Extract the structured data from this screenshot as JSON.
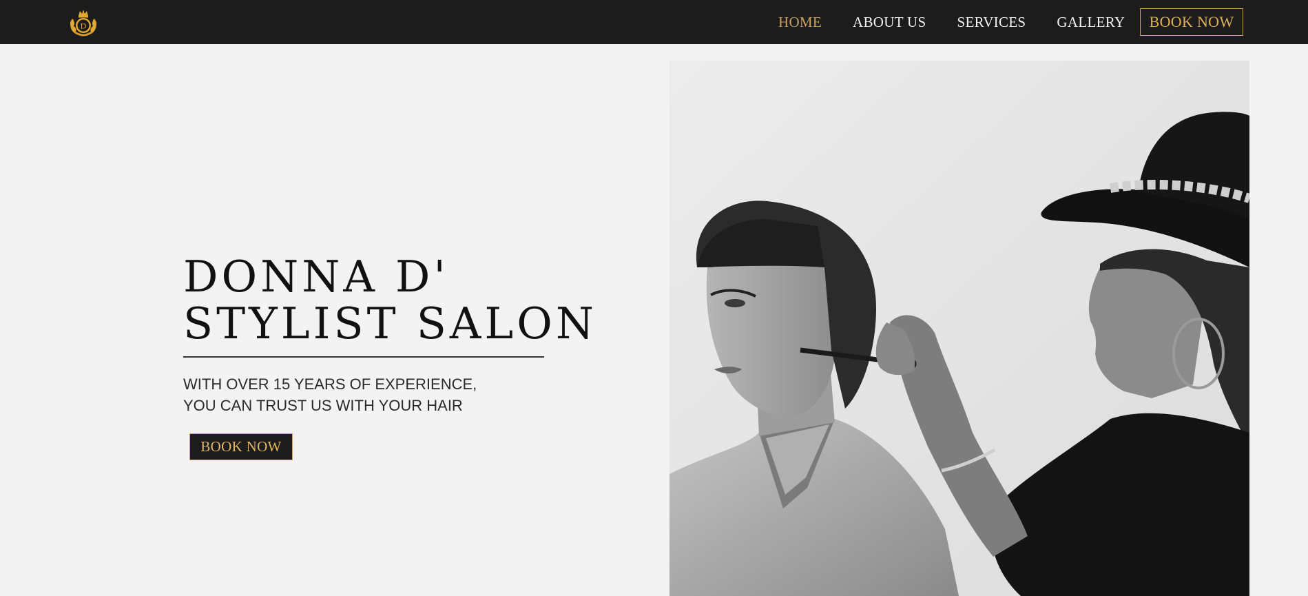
{
  "nav": {
    "logo_icon": "crown-laurel-d-logo-icon",
    "links": [
      {
        "label": "HOME",
        "active": true
      },
      {
        "label": "ABOUT US",
        "active": false
      },
      {
        "label": "SERVICES",
        "active": false
      },
      {
        "label": "GALLERY",
        "active": false
      }
    ],
    "cta_label": "BOOK NOW"
  },
  "hero": {
    "title_line1": "DONNA D'",
    "title_line2": "STYLIST SALON",
    "subtitle_line1": "WITH OVER 15 YEARS OF EXPERIENCE,",
    "subtitle_line2": "YOU CAN TRUST US WITH YOUR HAIR",
    "cta_label": "BOOK NOW"
  },
  "colors": {
    "nav_background": "#1c1c1c",
    "page_background": "#f3f3f3",
    "accent_gold": "#c9a05a",
    "text_dark": "#111111"
  }
}
